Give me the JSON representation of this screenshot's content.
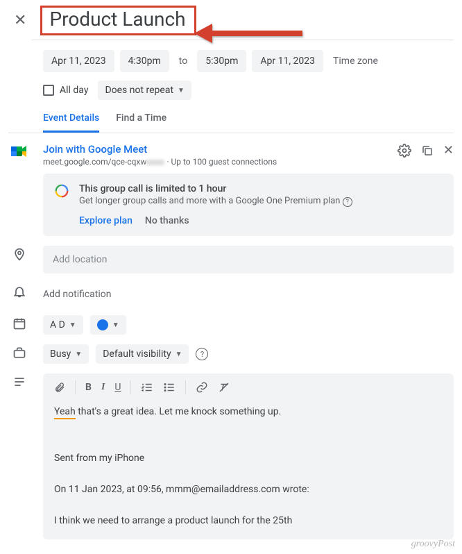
{
  "title": "Product Launch",
  "dates": {
    "start_date": "Apr 11, 2023",
    "start_time": "4:30pm",
    "to": "to",
    "end_time": "5:30pm",
    "end_date": "Apr 11, 2023",
    "timezone": "Time zone"
  },
  "allday": {
    "label": "All day",
    "repeat": "Does not repeat"
  },
  "tabs": {
    "details": "Event Details",
    "find": "Find a Time"
  },
  "meet": {
    "join": "Join with Google Meet",
    "url": "meet.google.com/qce-cqxw",
    "guests": "Up to 100 guest connections"
  },
  "promo": {
    "title": "This group call is limited to 1 hour",
    "sub": "Get longer group calls and more with a Google One Premium plan",
    "explore": "Explore plan",
    "nothanks": "No thanks"
  },
  "location": {
    "placeholder": "Add location"
  },
  "notification": {
    "label": "Add notification"
  },
  "calendar": {
    "label": "A D"
  },
  "busy": {
    "label": "Busy",
    "visibility": "Default visibility"
  },
  "desc": {
    "line1_pre": "Yeah",
    "line1_post": " that's a great idea. Let me knock something up.",
    "line2": "Sent from my iPhone",
    "line3": "On 11 Jan 2023, at 09:56, mmm@emailaddress.com wrote:",
    "line4": "I think we need to arrange a product launch for the 25th"
  },
  "watermark": "groovyPost"
}
